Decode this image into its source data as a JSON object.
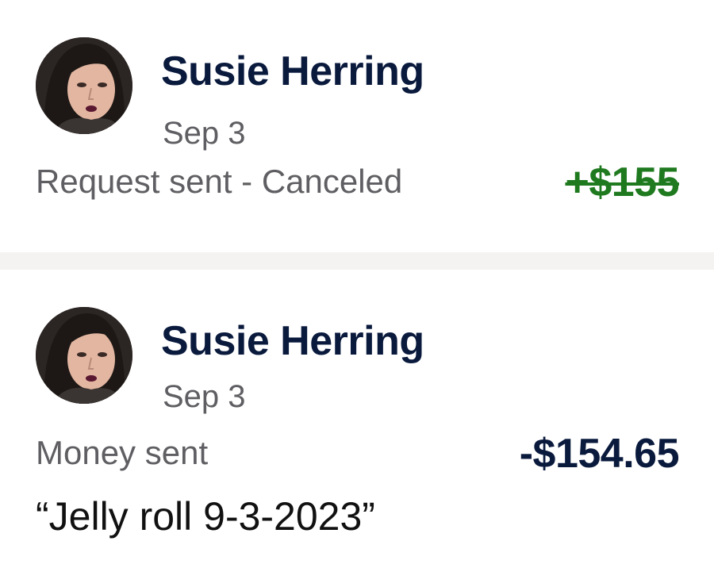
{
  "transactions": [
    {
      "name": "Susie Herring",
      "date": "Sep 3",
      "status": "Request sent - Canceled",
      "amount": "+$155",
      "amount_color": "#1f7a1f"
    },
    {
      "name": "Susie Herring",
      "date": "Sep 3",
      "status": "Money sent",
      "amount": "-$154.65",
      "amount_color": "#0a1a3d",
      "note": "“Jelly roll 9-3-2023”"
    }
  ],
  "colors": {
    "name": "#0a1a3d",
    "secondary_text": "#5f5f63",
    "divider": "#f5f3f1"
  },
  "icons": {
    "avatar": "user-photo-icon"
  }
}
